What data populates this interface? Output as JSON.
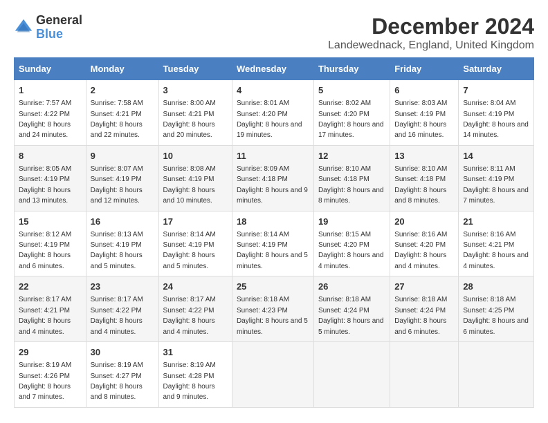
{
  "logo": {
    "general": "General",
    "blue": "Blue"
  },
  "title": "December 2024",
  "subtitle": "Landewednack, England, United Kingdom",
  "days_of_week": [
    "Sunday",
    "Monday",
    "Tuesday",
    "Wednesday",
    "Thursday",
    "Friday",
    "Saturday"
  ],
  "weeks": [
    [
      {
        "day": "1",
        "sunrise": "7:57 AM",
        "sunset": "4:22 PM",
        "daylight": "8 hours and 24 minutes."
      },
      {
        "day": "2",
        "sunrise": "7:58 AM",
        "sunset": "4:21 PM",
        "daylight": "8 hours and 22 minutes."
      },
      {
        "day": "3",
        "sunrise": "8:00 AM",
        "sunset": "4:21 PM",
        "daylight": "8 hours and 20 minutes."
      },
      {
        "day": "4",
        "sunrise": "8:01 AM",
        "sunset": "4:20 PM",
        "daylight": "8 hours and 19 minutes."
      },
      {
        "day": "5",
        "sunrise": "8:02 AM",
        "sunset": "4:20 PM",
        "daylight": "8 hours and 17 minutes."
      },
      {
        "day": "6",
        "sunrise": "8:03 AM",
        "sunset": "4:19 PM",
        "daylight": "8 hours and 16 minutes."
      },
      {
        "day": "7",
        "sunrise": "8:04 AM",
        "sunset": "4:19 PM",
        "daylight": "8 hours and 14 minutes."
      }
    ],
    [
      {
        "day": "8",
        "sunrise": "8:05 AM",
        "sunset": "4:19 PM",
        "daylight": "8 hours and 13 minutes."
      },
      {
        "day": "9",
        "sunrise": "8:07 AM",
        "sunset": "4:19 PM",
        "daylight": "8 hours and 12 minutes."
      },
      {
        "day": "10",
        "sunrise": "8:08 AM",
        "sunset": "4:19 PM",
        "daylight": "8 hours and 10 minutes."
      },
      {
        "day": "11",
        "sunrise": "8:09 AM",
        "sunset": "4:18 PM",
        "daylight": "8 hours and 9 minutes."
      },
      {
        "day": "12",
        "sunrise": "8:10 AM",
        "sunset": "4:18 PM",
        "daylight": "8 hours and 8 minutes."
      },
      {
        "day": "13",
        "sunrise": "8:10 AM",
        "sunset": "4:18 PM",
        "daylight": "8 hours and 8 minutes."
      },
      {
        "day": "14",
        "sunrise": "8:11 AM",
        "sunset": "4:19 PM",
        "daylight": "8 hours and 7 minutes."
      }
    ],
    [
      {
        "day": "15",
        "sunrise": "8:12 AM",
        "sunset": "4:19 PM",
        "daylight": "8 hours and 6 minutes."
      },
      {
        "day": "16",
        "sunrise": "8:13 AM",
        "sunset": "4:19 PM",
        "daylight": "8 hours and 5 minutes."
      },
      {
        "day": "17",
        "sunrise": "8:14 AM",
        "sunset": "4:19 PM",
        "daylight": "8 hours and 5 minutes."
      },
      {
        "day": "18",
        "sunrise": "8:14 AM",
        "sunset": "4:19 PM",
        "daylight": "8 hours and 5 minutes."
      },
      {
        "day": "19",
        "sunrise": "8:15 AM",
        "sunset": "4:20 PM",
        "daylight": "8 hours and 4 minutes."
      },
      {
        "day": "20",
        "sunrise": "8:16 AM",
        "sunset": "4:20 PM",
        "daylight": "8 hours and 4 minutes."
      },
      {
        "day": "21",
        "sunrise": "8:16 AM",
        "sunset": "4:21 PM",
        "daylight": "8 hours and 4 minutes."
      }
    ],
    [
      {
        "day": "22",
        "sunrise": "8:17 AM",
        "sunset": "4:21 PM",
        "daylight": "8 hours and 4 minutes."
      },
      {
        "day": "23",
        "sunrise": "8:17 AM",
        "sunset": "4:22 PM",
        "daylight": "8 hours and 4 minutes."
      },
      {
        "day": "24",
        "sunrise": "8:17 AM",
        "sunset": "4:22 PM",
        "daylight": "8 hours and 4 minutes."
      },
      {
        "day": "25",
        "sunrise": "8:18 AM",
        "sunset": "4:23 PM",
        "daylight": "8 hours and 5 minutes."
      },
      {
        "day": "26",
        "sunrise": "8:18 AM",
        "sunset": "4:24 PM",
        "daylight": "8 hours and 5 minutes."
      },
      {
        "day": "27",
        "sunrise": "8:18 AM",
        "sunset": "4:24 PM",
        "daylight": "8 hours and 6 minutes."
      },
      {
        "day": "28",
        "sunrise": "8:18 AM",
        "sunset": "4:25 PM",
        "daylight": "8 hours and 6 minutes."
      }
    ],
    [
      {
        "day": "29",
        "sunrise": "8:19 AM",
        "sunset": "4:26 PM",
        "daylight": "8 hours and 7 minutes."
      },
      {
        "day": "30",
        "sunrise": "8:19 AM",
        "sunset": "4:27 PM",
        "daylight": "8 hours and 8 minutes."
      },
      {
        "day": "31",
        "sunrise": "8:19 AM",
        "sunset": "4:28 PM",
        "daylight": "8 hours and 9 minutes."
      },
      null,
      null,
      null,
      null
    ]
  ]
}
